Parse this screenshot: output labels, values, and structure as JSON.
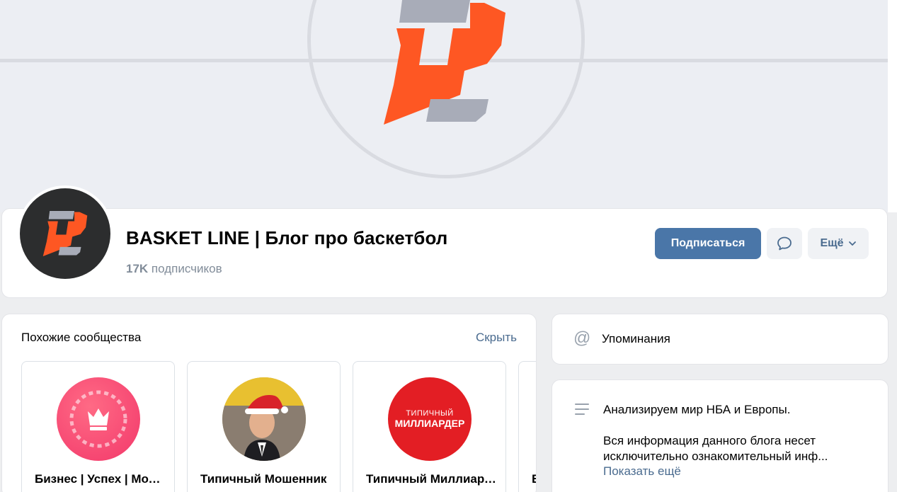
{
  "group": {
    "name": "BASKET LINE | Блог про баскетбол",
    "subscribers_count": "17K",
    "subscribers_label": "подписчиков"
  },
  "actions": {
    "subscribe_label": "Подписаться",
    "more_label": "Ещё"
  },
  "similar": {
    "title": "Похожие сообщества",
    "hide_label": "Скрыть",
    "items": [
      {
        "name": "Бизнес | Успех | Мотивация"
      },
      {
        "name": "Типичный Мошенник"
      },
      {
        "name": "Типичный Миллиардер",
        "avatar_text_top": "ТИПИЧНЫЙ",
        "avatar_text_bottom": "МИЛЛИАРДЕР"
      },
      {
        "name": "Б"
      }
    ]
  },
  "mentions": {
    "label": "Упоминания"
  },
  "about": {
    "line1": "Анализируем мир НБА и Европы.",
    "line2": "Вся информация данного блога несет исключительно ознакомительный инф...",
    "show_more": "Показать ещё"
  },
  "colors": {
    "brand_orange": "#fe5723",
    "brand_gray": "#a8acb8",
    "primary_button": "#4a76a8",
    "link": "#4a6b8f"
  }
}
